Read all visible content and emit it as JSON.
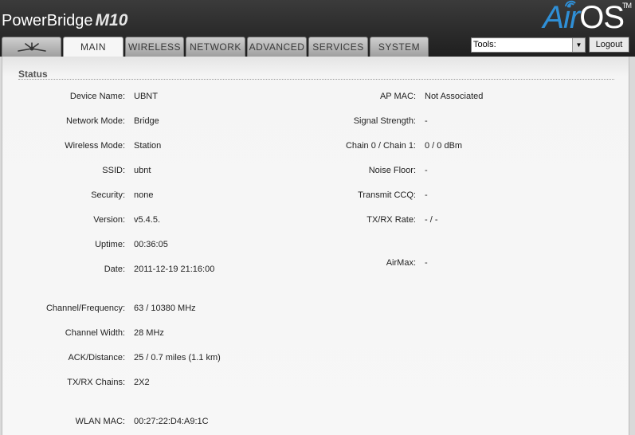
{
  "header": {
    "product": "PowerBridge",
    "model": "M10",
    "logo_air": "Air",
    "logo_os": "OS",
    "logo_tm": "TM"
  },
  "tabs": [
    {
      "label": "",
      "icon": "ubiquiti-logo-icon"
    },
    {
      "label": "MAIN",
      "active": true
    },
    {
      "label": "WIRELESS"
    },
    {
      "label": "NETWORK"
    },
    {
      "label": "ADVANCED"
    },
    {
      "label": "SERVICES"
    },
    {
      "label": "SYSTEM"
    }
  ],
  "tools": {
    "selected": "Tools:"
  },
  "logout_label": "Logout",
  "status": {
    "title": "Status",
    "left": [
      {
        "label": "Device Name:",
        "value": "UBNT"
      },
      {
        "label": "Network Mode:",
        "value": "Bridge"
      },
      {
        "label": "Wireless Mode:",
        "value": "Station"
      },
      {
        "label": "SSID:",
        "value": "ubnt"
      },
      {
        "label": "Security:",
        "value": "none"
      },
      {
        "label": "Version:",
        "value": "v5.4.5."
      },
      {
        "label": "Uptime:",
        "value": "00:36:05"
      },
      {
        "label": "Date:",
        "value": "2011-12-19 21:16:00"
      },
      {
        "label": "Channel/Frequency:",
        "value": "63 / 10380 MHz"
      },
      {
        "label": "Channel Width:",
        "value": "28 MHz"
      },
      {
        "label": "ACK/Distance:",
        "value": "25 / 0.7 miles (1.1 km)"
      },
      {
        "label": "TX/RX Chains:",
        "value": "2X2"
      },
      {
        "label": "WLAN MAC:",
        "value": "00:27:22:D4:A9:1C"
      }
    ],
    "right": [
      {
        "label": "AP MAC:",
        "value": "Not Associated"
      },
      {
        "label": "Signal Strength:",
        "value": "-"
      },
      {
        "label": "Chain 0 / Chain 1:",
        "value": "0 / 0 dBm"
      },
      {
        "label": "Noise Floor:",
        "value": "-"
      },
      {
        "label": "Transmit CCQ:",
        "value": "-"
      },
      {
        "label": "TX/RX Rate:",
        "value": "- / -"
      },
      {
        "label": "AirMax:",
        "value": "-"
      }
    ]
  }
}
